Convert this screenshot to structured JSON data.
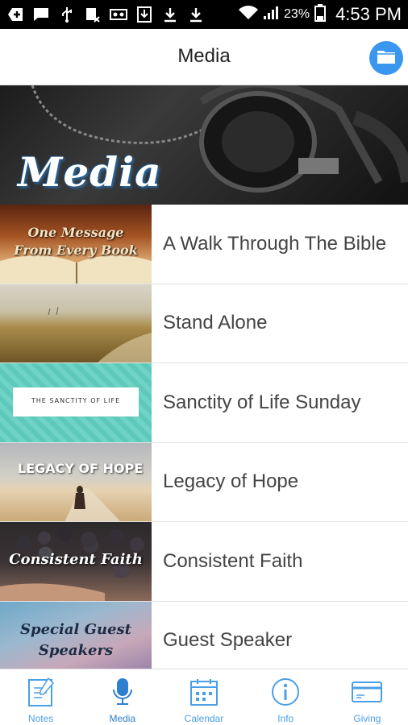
{
  "status_bar": {
    "battery_percent": "23%",
    "time": "4:53 PM"
  },
  "header": {
    "title": "Media"
  },
  "banner": {
    "title": "Media"
  },
  "items": [
    {
      "label": "A Walk Through The Bible",
      "thumb_text": "One Message From Every Book"
    },
    {
      "label": "Stand Alone",
      "thumb_text": ""
    },
    {
      "label": "Sanctity of Life Sunday",
      "thumb_text": "THE SANCTITY OF LIFE"
    },
    {
      "label": "Legacy of Hope",
      "thumb_text": "LEGACY OF HOPE"
    },
    {
      "label": "Consistent Faith",
      "thumb_text": "Consistent Faith"
    },
    {
      "label": "Guest Speaker",
      "thumb_text": "Special Guest Speakers"
    }
  ],
  "tabs": [
    {
      "label": "Notes"
    },
    {
      "label": "Media"
    },
    {
      "label": "Calendar"
    },
    {
      "label": "Info"
    },
    {
      "label": "Giving"
    }
  ],
  "colors": {
    "accent": "#3a97f0",
    "tab_label": "#4a9fe6"
  }
}
